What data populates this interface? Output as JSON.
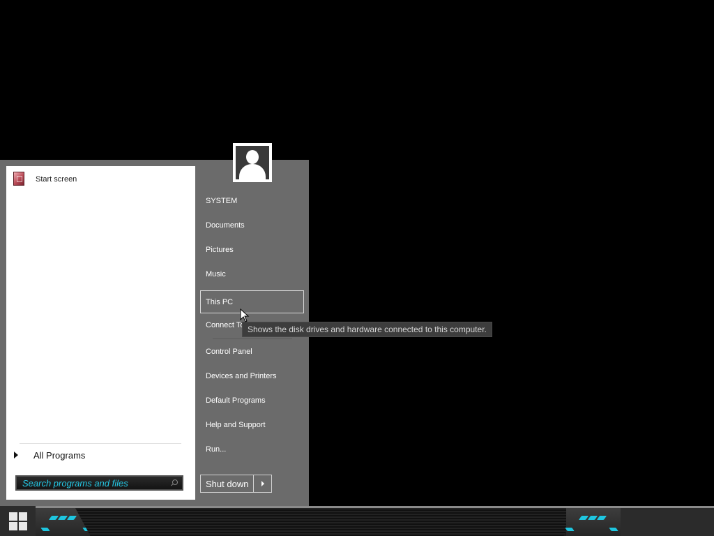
{
  "start_menu": {
    "pinned": [
      {
        "label": "Start screen",
        "icon": "start-screen-icon"
      }
    ],
    "all_programs_label": "All Programs",
    "search": {
      "placeholder": "Search programs and files"
    },
    "right_items": [
      {
        "label": "SYSTEM"
      },
      {
        "label": "Documents"
      },
      {
        "label": "Pictures"
      },
      {
        "label": "Music"
      },
      {
        "label": "This PC",
        "hovered": true
      },
      {
        "label": "Connect To"
      },
      {
        "label": "Control Panel"
      },
      {
        "label": "Devices and Printers"
      },
      {
        "label": "Default Programs"
      },
      {
        "label": "Help and Support"
      },
      {
        "label": "Run..."
      }
    ],
    "shutdown_label": "Shut down",
    "user_picture_icon": "user-avatar-icon"
  },
  "tooltip": {
    "text": "Shows the disk drives and hardware connected to this computer."
  },
  "taskbar": {
    "start_icon": "windows-logo-icon",
    "accent_color": "#1ec6e0"
  },
  "colors": {
    "menu_right_bg": "#6b6b6b",
    "menu_left_bg": "#ffffff",
    "search_text": "#24c9e6"
  }
}
